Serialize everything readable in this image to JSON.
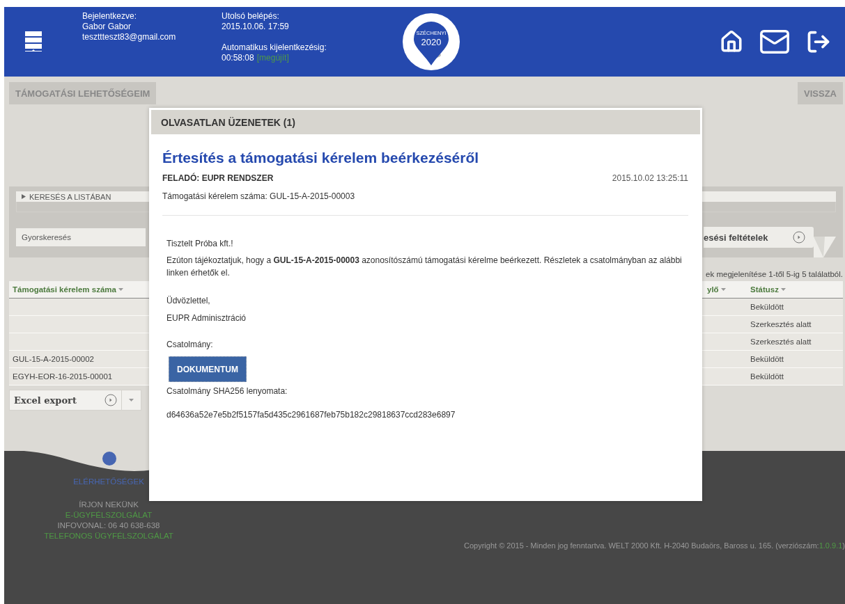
{
  "header": {
    "login_label": "Bejelentkezve:",
    "user_name": "Gabor Gabor",
    "email": "teszttteszt83@gmail.com",
    "last_login_label": "Utolsó belépés:",
    "last_login": "2015.10.06. 17:59",
    "auto_logout_label": "Automatikus kijelentkezésig:",
    "auto_logout_time": "00:58:08",
    "renew_link": "[megújít]",
    "logo": {
      "line_1": "SZÉCHENYI",
      "line_2": "2020"
    }
  },
  "nav": {
    "left_button": "TÁMOGATÁSI LEHETŐSÉGEIM",
    "right_button": "VISSZA"
  },
  "search_panel": {
    "toggle": "KERESÉS A LISTÁBAN",
    "expanded": false,
    "quick_search_placeholder": "Gyorskeresés",
    "criteria_button": "esési feltételek"
  },
  "results_info": "ek megjelenítése 1-től 5-ig 5 találatból.",
  "table": {
    "columns": [
      "Támogatási kérelem száma",
      "ylő",
      "Státusz"
    ],
    "rows": [
      {
        "status": "Beküldött"
      },
      {
        "status": "Szerkesztés alatt"
      },
      {
        "status": "Szerkesztés alatt"
      },
      {
        "number": "GUL-15-A-2015-00002",
        "status": "Beküldött"
      },
      {
        "number": "EGYH-EOR-16-2015-00001",
        "status": "Beküldött"
      }
    ]
  },
  "export_button": "Excel export",
  "modal": {
    "header": "OLVASATLAN ÜZENETEK (1)",
    "title": "Értesítés a támogatási kérelem beérkezéséről",
    "sender": "FELADÓ: EUPR RENDSZER",
    "date": "2015.10.02 13:25:11",
    "reference": "Támogatási kérelem száma: GUL-15-A-2015-00003",
    "greeting": "Tisztelt Próba kft.!",
    "body": "Ezúton tájékoztatjuk, hogy a **GUL-15-A-2015-00003** azonosítószámú támogatási kérelme beérkezett. Részletek a csatolmányban az alábbi linken érhetők el.",
    "closing": "Üdvözlettel,",
    "signature": "EUPR Adminisztráció",
    "attachment_label": "Csatolmány:",
    "document_button": "DOKUMENTUM",
    "hash_label": "Csatolmány SHA256 lenyomata:",
    "hash": "d64636a52e7e5b2f5157fa5d435c2961687feb75b182c29818637ccd283e6897"
  },
  "footer": {
    "contacts_title": "ELÉRHETŐSÉGEK",
    "links": [
      {
        "text": "ÍRJON NEKÜNK",
        "kind": "label"
      },
      {
        "text": "E-ÜGYFÉLSZOLGÁLAT",
        "kind": "link"
      },
      {
        "text": "INFOVONAL: 06 40 638-638",
        "kind": "label"
      },
      {
        "text": "TELEFONOS ÜGYFÉLSZOLGÁLAT",
        "kind": "link"
      }
    ],
    "copyright": "Copyright © 2015 - Minden jog fenntartva. WELT 2000 Kft. H-2040 Budaörs, Baross u. 165. (verziószám:",
    "version": "1.0.9.1",
    "version_close": ")"
  }
}
